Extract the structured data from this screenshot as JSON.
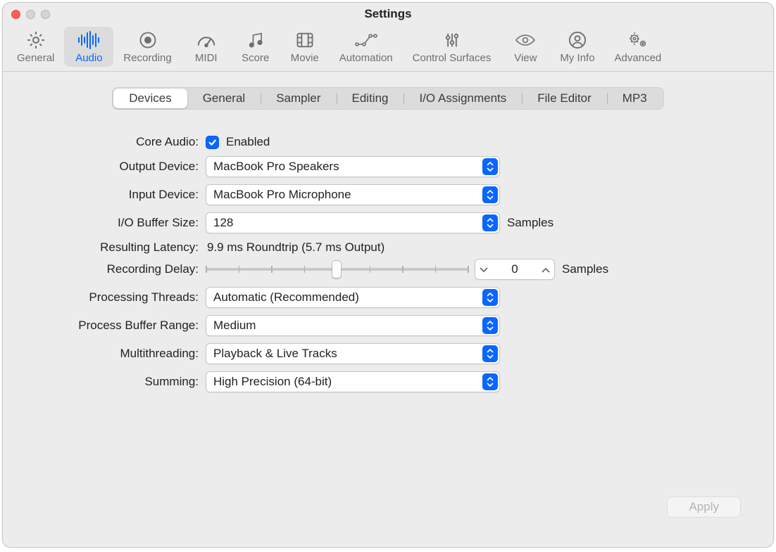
{
  "window_title": "Settings",
  "toolbar": [
    {
      "id": "general",
      "label": "General",
      "icon": "gear-icon"
    },
    {
      "id": "audio",
      "label": "Audio",
      "icon": "waveform-icon",
      "active": true
    },
    {
      "id": "recording",
      "label": "Recording",
      "icon": "record-icon"
    },
    {
      "id": "midi",
      "label": "MIDI",
      "icon": "gauge-icon"
    },
    {
      "id": "score",
      "label": "Score",
      "icon": "notes-icon"
    },
    {
      "id": "movie",
      "label": "Movie",
      "icon": "film-icon"
    },
    {
      "id": "automation",
      "label": "Automation",
      "icon": "automation-icon"
    },
    {
      "id": "control-surfaces",
      "label": "Control Surfaces",
      "icon": "sliders-icon"
    },
    {
      "id": "view",
      "label": "View",
      "icon": "eye-icon"
    },
    {
      "id": "my-info",
      "label": "My Info",
      "icon": "person-icon"
    },
    {
      "id": "advanced",
      "label": "Advanced",
      "icon": "gears-icon"
    }
  ],
  "subtabs": [
    {
      "id": "devices",
      "label": "Devices",
      "active": true
    },
    {
      "id": "general",
      "label": "General"
    },
    {
      "id": "sampler",
      "label": "Sampler"
    },
    {
      "id": "editing",
      "label": "Editing"
    },
    {
      "id": "io-assignments",
      "label": "I/O Assignments"
    },
    {
      "id": "file-editor",
      "label": "File Editor"
    },
    {
      "id": "mp3",
      "label": "MP3"
    }
  ],
  "labels": {
    "core_audio": "Core Audio:",
    "enabled": "Enabled",
    "output_device": "Output Device:",
    "input_device": "Input Device:",
    "io_buffer_size": "I/O Buffer Size:",
    "samples": "Samples",
    "resulting_latency": "Resulting Latency:",
    "recording_delay": "Recording Delay:",
    "processing_threads": "Processing Threads:",
    "process_buffer_range": "Process Buffer Range:",
    "multithreading": "Multithreading:",
    "summing": "Summing:",
    "apply": "Apply"
  },
  "values": {
    "core_audio_enabled": true,
    "output_device": "MacBook Pro Speakers",
    "input_device": "MacBook Pro Microphone",
    "io_buffer_size": "128",
    "resulting_latency": "9.9 ms Roundtrip (5.7 ms Output)",
    "recording_delay": "0",
    "processing_threads": "Automatic (Recommended)",
    "process_buffer_range": "Medium",
    "multithreading": "Playback & Live Tracks",
    "summing": "High Precision (64-bit)"
  }
}
